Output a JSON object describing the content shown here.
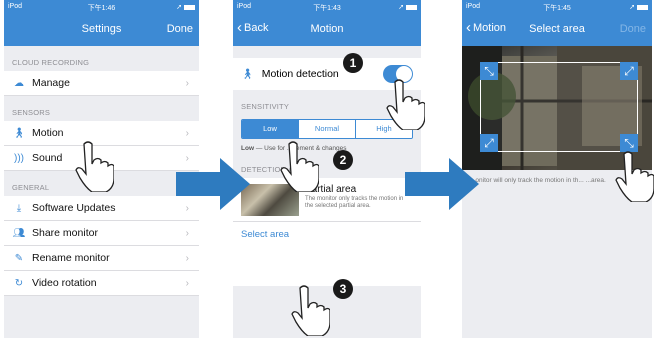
{
  "panel1": {
    "status": {
      "carrier": "iPod",
      "time": "下午1:46"
    },
    "nav": {
      "title": "Settings",
      "right": "Done"
    },
    "sections": [
      {
        "header": "CLOUD RECORDING",
        "items": [
          {
            "label": "Manage",
            "icon": "cloud-icon"
          }
        ]
      },
      {
        "header": "SENSORS",
        "items": [
          {
            "label": "Motion",
            "icon": "walking-person-icon"
          },
          {
            "label": "Sound",
            "icon": "sound-waves-icon"
          }
        ]
      },
      {
        "header": "GENERAL",
        "items": [
          {
            "label": "Software Updates",
            "icon": "download-tray-icon"
          },
          {
            "label": "Share monitor",
            "icon": "people-icon"
          },
          {
            "label": "Rename monitor",
            "icon": "pencil-icon"
          },
          {
            "label": "Video rotation",
            "icon": "rotate-icon"
          }
        ]
      }
    ]
  },
  "panel2": {
    "status": {
      "carrier": "iPod",
      "time": "下午1:43"
    },
    "nav": {
      "back": "Back",
      "title": "Motion"
    },
    "motion_label": "Motion detection",
    "motion_enabled": true,
    "sensitivity_header": "SENSITIVITY",
    "sensitivity_options": [
      "Low",
      "Normal",
      "High"
    ],
    "sensitivity_selected": "Low",
    "sensitivity_desc_bold": "Low",
    "sensitivity_desc": "— Use for ...gement & changes",
    "detection_header": "DETECTION AREA",
    "partial_title": "Partial area",
    "partial_desc": "The monitor only tracks the motion in the selected partial area.",
    "select_area": "Select area"
  },
  "panel3": {
    "status": {
      "carrier": "iPod",
      "time": "下午1:45"
    },
    "nav": {
      "back": "Motion",
      "title": "Select area",
      "right": "Done"
    },
    "caption": "...onitor will only track the motion in th... ...area."
  },
  "badges": [
    "1",
    "2",
    "3"
  ],
  "colors": {
    "accent": "#3d8ad4",
    "arrow": "#2e7bbf"
  }
}
